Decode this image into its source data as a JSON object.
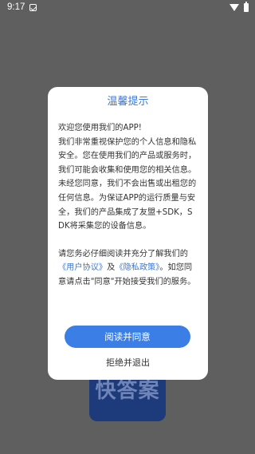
{
  "status_bar": {
    "time": "9:17",
    "notification_icon": "download-check-icon",
    "wifi_icon": "wifi-icon",
    "battery_icon": "battery-icon"
  },
  "background": {
    "logo_text": "快答案",
    "logo_color": "#1d3a7a"
  },
  "dialog": {
    "title": "温馨提示",
    "body_line_1": "欢迎您使用我们的APP!",
    "body_main": "我们非常重视保护您的个人信息和隐私安全。您在使用我们的产品或服务时，我们可能会收集和使用您的相关信息。未经您同意，我们不会出售或出租您的任何信息。为保证APP的运行质量与安全，我们的产品集成了友盟+SDK，SDK将采集您的设备信息。",
    "para2_prefix": "请您务必仔细阅读并充分了解我们的",
    "user_agreement_link": "《用户协议》",
    "and_text": "及",
    "privacy_policy_link": "《隐私政策》",
    "para2_suffix": "。如您同意请点击\"同意\"开始接受我们的服务。",
    "agree_label": "阅读并同意",
    "reject_label": "拒绝并退出",
    "accent_color": "#3b78d8"
  }
}
